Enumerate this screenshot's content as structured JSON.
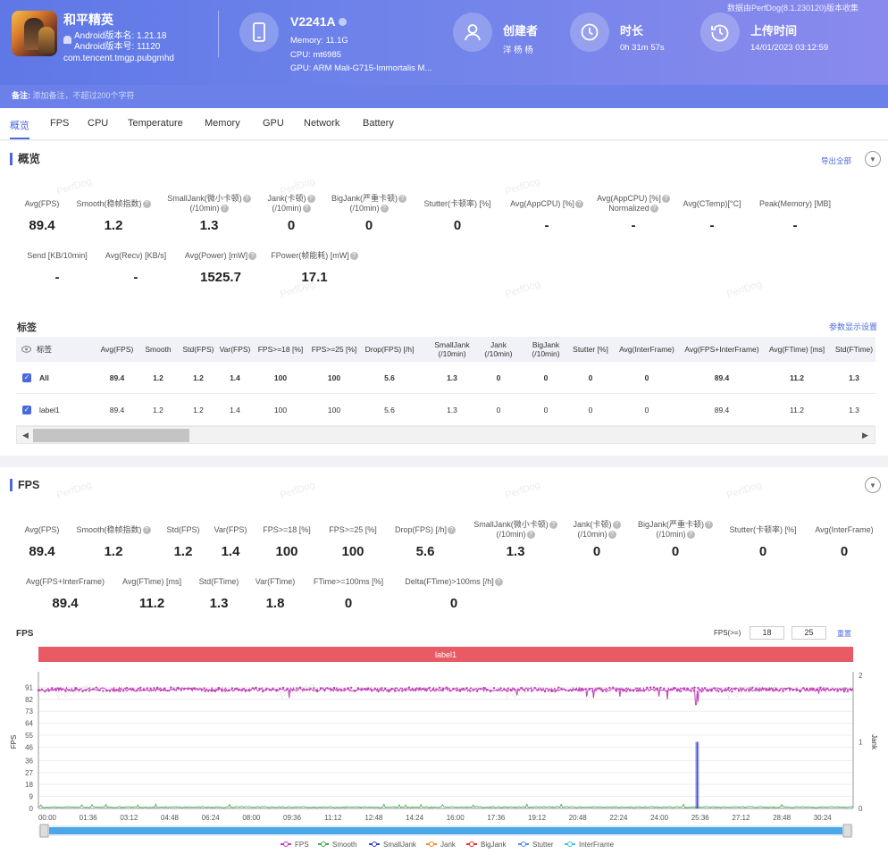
{
  "header": {
    "app_name": "和平精英",
    "android_name": "Android版本名: 1.21.18",
    "android_code": "Android版本号: 11120",
    "package": "com.tencent.tmgp.pubgmhd",
    "device_model": "V2241A",
    "memory": "Memory: 11.1G",
    "cpu": "CPU: mt6985",
    "gpu": "GPU: ARM Mali-G715-Immortalis M...",
    "creator_label": "创建者",
    "creator_value": "洋 杨 杨",
    "duration_label": "时长",
    "duration_value": "0h 31m 57s",
    "upload_label": "上传时间",
    "upload_value": "14/01/2023 03:12:59",
    "data_source_note": "数据由PerfDog(8.1.230120)版本收集",
    "remark_label": "备注:",
    "remark_placeholder": "添加备注，不超过200个字符"
  },
  "tabs": [
    "概览",
    "FPS",
    "CPU",
    "Temperature",
    "Memory",
    "GPU",
    "Network",
    "Battery"
  ],
  "watermark": "PerfDog",
  "overview": {
    "title": "概览",
    "export_label": "导出全部",
    "row1": [
      {
        "label": "Avg(FPS)",
        "value": "89.4"
      },
      {
        "label": "Smooth(稳帧指数)",
        "value": "1.2"
      },
      {
        "label": "SmallJank(微小卡顿)\n(/10min)",
        "value": "1.3"
      },
      {
        "label": "Jank(卡顿)\n(/10min)",
        "value": "0"
      },
      {
        "label": "BigJank(严重卡顿)\n(/10min)",
        "value": "0"
      },
      {
        "label": "Stutter(卡顿率) [%]",
        "value": "0"
      },
      {
        "label": "Avg(AppCPU) [%]",
        "value": "-"
      },
      {
        "label": "Avg(AppCPU) [%]\nNormalized",
        "value": "-"
      },
      {
        "label": "Avg(CTemp)[°C]",
        "value": "-"
      },
      {
        "label": "Peak(Memory) [MB]",
        "value": "-"
      }
    ],
    "row2": [
      {
        "label": "Send [KB/10min]",
        "value": "-"
      },
      {
        "label": "Avg(Recv) [KB/s]",
        "value": "-"
      },
      {
        "label": "Avg(Power) [mW]",
        "value": "1525.7"
      },
      {
        "label": "FPower(帧能耗) [mW]",
        "value": "17.1"
      }
    ],
    "tags_title": "标签",
    "param_link": "参数显示设置",
    "table": {
      "headers": [
        "标签",
        "Avg(FPS)",
        "Smooth",
        "Std(FPS)",
        "Var(FPS)",
        "FPS>=18 [%]",
        "FPS>=25 [%]",
        "Drop(FPS) [/h]",
        "SmallJank\n(/10min)",
        "Jank\n(/10min)",
        "BigJank\n(/10min)",
        "Stutter [%]",
        "Avg(InterFrame)",
        "Avg(FPS+InterFrame)",
        "Avg(FTime) [ms]",
        "Std(FTime)"
      ],
      "rows": [
        [
          "All",
          "89.4",
          "1.2",
          "1.2",
          "1.4",
          "100",
          "100",
          "5.6",
          "1.3",
          "0",
          "0",
          "0",
          "0",
          "89.4",
          "11.2",
          "1.3"
        ],
        [
          "label1",
          "89.4",
          "1.2",
          "1.2",
          "1.4",
          "100",
          "100",
          "5.6",
          "1.3",
          "0",
          "0",
          "0",
          "0",
          "89.4",
          "11.2",
          "1.3"
        ]
      ]
    }
  },
  "fps_section": {
    "title": "FPS",
    "row1": [
      {
        "label": "Avg(FPS)",
        "value": "89.4"
      },
      {
        "label": "Smooth(稳帧指数)",
        "value": "1.2"
      },
      {
        "label": "Std(FPS)",
        "value": "1.2"
      },
      {
        "label": "Var(FPS)",
        "value": "1.4"
      },
      {
        "label": "FPS>=18 [%]",
        "value": "100"
      },
      {
        "label": "FPS>=25 [%]",
        "value": "100"
      },
      {
        "label": "Drop(FPS) [/h]",
        "value": "5.6"
      },
      {
        "label": "SmallJank(微小卡顿)\n(/10min)",
        "value": "1.3"
      },
      {
        "label": "Jank(卡顿)\n(/10min)",
        "value": "0"
      },
      {
        "label": "BigJank(严重卡顿)\n(/10min)",
        "value": "0"
      },
      {
        "label": "Stutter(卡顿率) [%]",
        "value": "0"
      },
      {
        "label": "Avg(InterFrame)",
        "value": "0"
      }
    ],
    "row2": [
      {
        "label": "Avg(FPS+InterFrame)",
        "value": "89.4"
      },
      {
        "label": "Avg(FTime) [ms]",
        "value": "11.2"
      },
      {
        "label": "Std(FTime)",
        "value": "1.3"
      },
      {
        "label": "Var(FTime)",
        "value": "1.8"
      },
      {
        "label": "FTime>=100ms [%]",
        "value": "0"
      },
      {
        "label": "Delta(FTime)>100ms [/h]",
        "value": "0"
      }
    ],
    "fps_threshold_label": "FPS(>=)",
    "fps_threshold_1": "18",
    "fps_threshold_2": "25",
    "reset_label": "重置"
  },
  "chart_data": {
    "type": "line",
    "title": "FPS",
    "band_label": "label1",
    "ylabel": "FPS",
    "y2label": "Jank",
    "yticks": [
      0,
      9,
      18,
      27,
      36,
      46,
      55,
      64,
      73,
      82,
      91
    ],
    "y2ticks": [
      0,
      1,
      2
    ],
    "ylim": [
      0,
      100
    ],
    "y2lim": [
      0,
      2
    ],
    "xticks": [
      "00:00",
      "01:36",
      "03:12",
      "04:48",
      "06:24",
      "08:00",
      "09:36",
      "11:12",
      "12:48",
      "14:24",
      "16:00",
      "17:36",
      "19:12",
      "20:48",
      "22:24",
      "24:00",
      "25:36",
      "27:12",
      "28:48",
      "30:24"
    ],
    "duration_seconds": 1917,
    "fps_baseline": 89.4,
    "fps_dips": [
      [
        15,
        88
      ],
      [
        590,
        83
      ],
      [
        1126,
        85
      ],
      [
        1290,
        84
      ],
      [
        1306,
        83
      ],
      [
        1368,
        84
      ],
      [
        1460,
        84
      ],
      [
        1480,
        82
      ],
      [
        1547,
        78
      ],
      [
        1552,
        80
      ],
      [
        1836,
        86
      ]
    ],
    "smalljank_spike_at": 1550,
    "smalljank_spike_value": 1,
    "series": [
      {
        "name": "FPS",
        "color": "#c13fb8"
      },
      {
        "name": "Smooth",
        "color": "#3fae4c"
      },
      {
        "name": "SmallJank",
        "color": "#3a3fd8"
      },
      {
        "name": "Jank",
        "color": "#f08a2a"
      },
      {
        "name": "BigJank",
        "color": "#e0322c"
      },
      {
        "name": "Stutter",
        "color": "#4f8de0"
      },
      {
        "name": "InterFrame",
        "color": "#3cc6dc"
      }
    ],
    "band_color": "#e85a64",
    "slider_color": "#4aa8e8"
  }
}
